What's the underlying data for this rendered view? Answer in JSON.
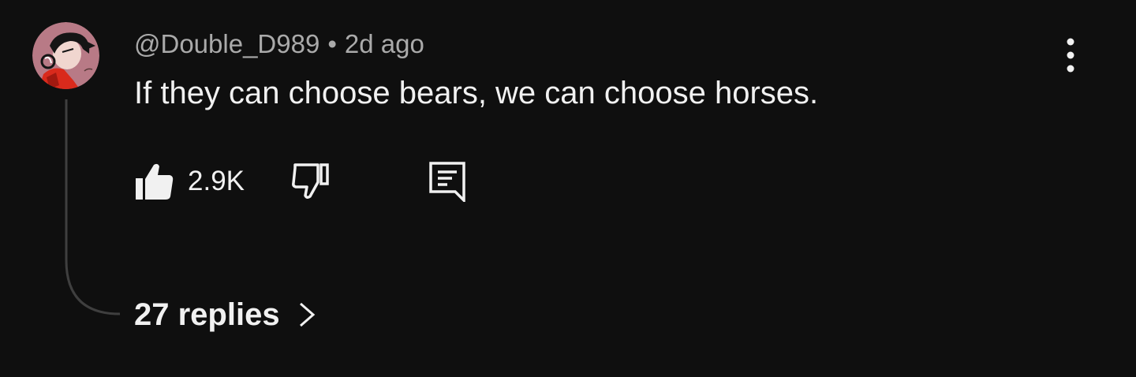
{
  "comment": {
    "author": "@Double_D989",
    "separator": "•",
    "timestamp": "2d ago",
    "text": "If they can choose bears, we can choose horses.",
    "like_count": "2.9K",
    "replies_label": "27 replies"
  },
  "icons": {
    "avatar": "avatar-illustration",
    "more": "more-vert-icon",
    "like": "thumbs-up-icon",
    "dislike": "thumbs-down-icon",
    "reply": "comment-reply-icon",
    "expand": "chevron-right-icon"
  },
  "colors": {
    "background": "#0f0f0f",
    "primary_text": "#f1f1f1",
    "secondary_text": "#aaaaaa",
    "thread_line": "#3f3f3f"
  }
}
